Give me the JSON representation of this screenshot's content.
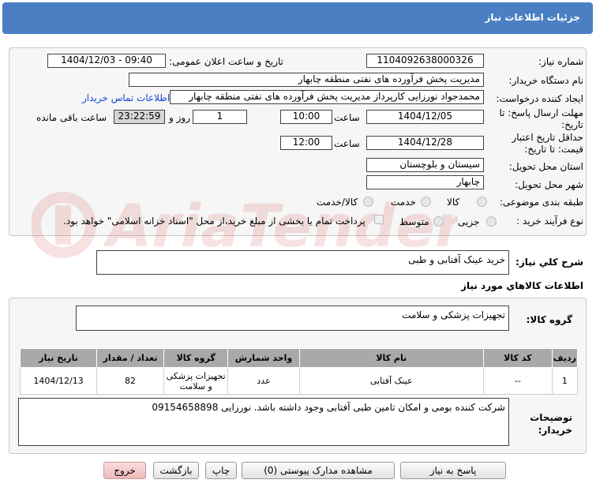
{
  "window": {
    "title": "جزئیات اطلاعات نیاز"
  },
  "form": {
    "need_number_label": "شماره نیاز:",
    "need_number": "1104092638000326",
    "announce_label": "تاریخ و ساعت اعلان عمومی:",
    "announce_value": "1404/12/03 - 09:40",
    "buyer_org_label": "نام دستگاه خریدار:",
    "buyer_org": "مدیریت پخش فرآورده های نفتی منطقه چابهار",
    "requester_label": "ایجاد کننده درخواست:",
    "requester": "محمدجواد نورزایی کارپرداز مدیریت پخش فرآورده های نفتی منطقه چابهار",
    "contact_link": "اطلاعات تماس خریدار",
    "reply_deadline_label": "مهلت ارسال پاسخ: تا تاریخ:",
    "reply_date": "1404/12/05",
    "time_label": "ساعت",
    "reply_time": "10:00",
    "day_label": "روز و",
    "days": "1",
    "remaining": "23:22:59",
    "remaining_label": "ساعت باقی مانده",
    "price_validity_label": "حداقل تاریخ اعتبار قیمت: تا تاریخ:",
    "price_date": "1404/12/28",
    "time_label2": "ساعت",
    "price_time": "12:00",
    "province_label": "استان محل تحویل:",
    "province": "سیستان و بلوچستان",
    "city_label": "شهر محل تحویل:",
    "city": "چابهار",
    "category_label": "طبقه بندی موضوعی:",
    "category_options": [
      "کالا",
      "خدمت",
      "کالا/خدمت"
    ],
    "process_label": "نوع فرآیند خرید :",
    "process_options": [
      "جزیی",
      "متوسط"
    ],
    "payment_note": "پرداخت تمام یا بخشی از مبلغ خرید،از محل \"اسناد خزانه اسلامی\" خواهد بود."
  },
  "description": {
    "label": "شرح کلي نياز:",
    "value": "خرید عینک آفتابی و طبی"
  },
  "goods_info": {
    "heading": "اطلاعات کالاهاي مورد نياز",
    "group_label": "گروه کالا:",
    "group_value": "تجهیزات پزشکی و سلامت"
  },
  "table": {
    "headers": [
      "ردیف",
      "کد کالا",
      "نام کالا",
      "واحد شمارش",
      "گروه کالا",
      "تعداد / مقدار",
      "تاریخ نیاز"
    ],
    "rows": [
      [
        "1",
        "--",
        "عینک آفتابی",
        "عدد",
        "تجهیزات پزشکی و سلامت",
        "82",
        "1404/12/13"
      ]
    ]
  },
  "buyer_notes": {
    "label": "توضیحات خریدار:",
    "value": "شرکت کننده بومی و امکان تامین طبی آفتابی وجود داشته باشد. نورزایی 09154658898"
  },
  "buttons": {
    "reply": "پاسخ به نیاز",
    "attachments": "مشاهده مدارک پیوستی (0)",
    "print": "چاپ",
    "back": "بازگشت",
    "exit": "خروج"
  },
  "colors": {
    "header": "#4a7fc4",
    "link": "#1a45d6",
    "table_header": "#a9a9a9",
    "exit_button": "#f1b9b9"
  }
}
